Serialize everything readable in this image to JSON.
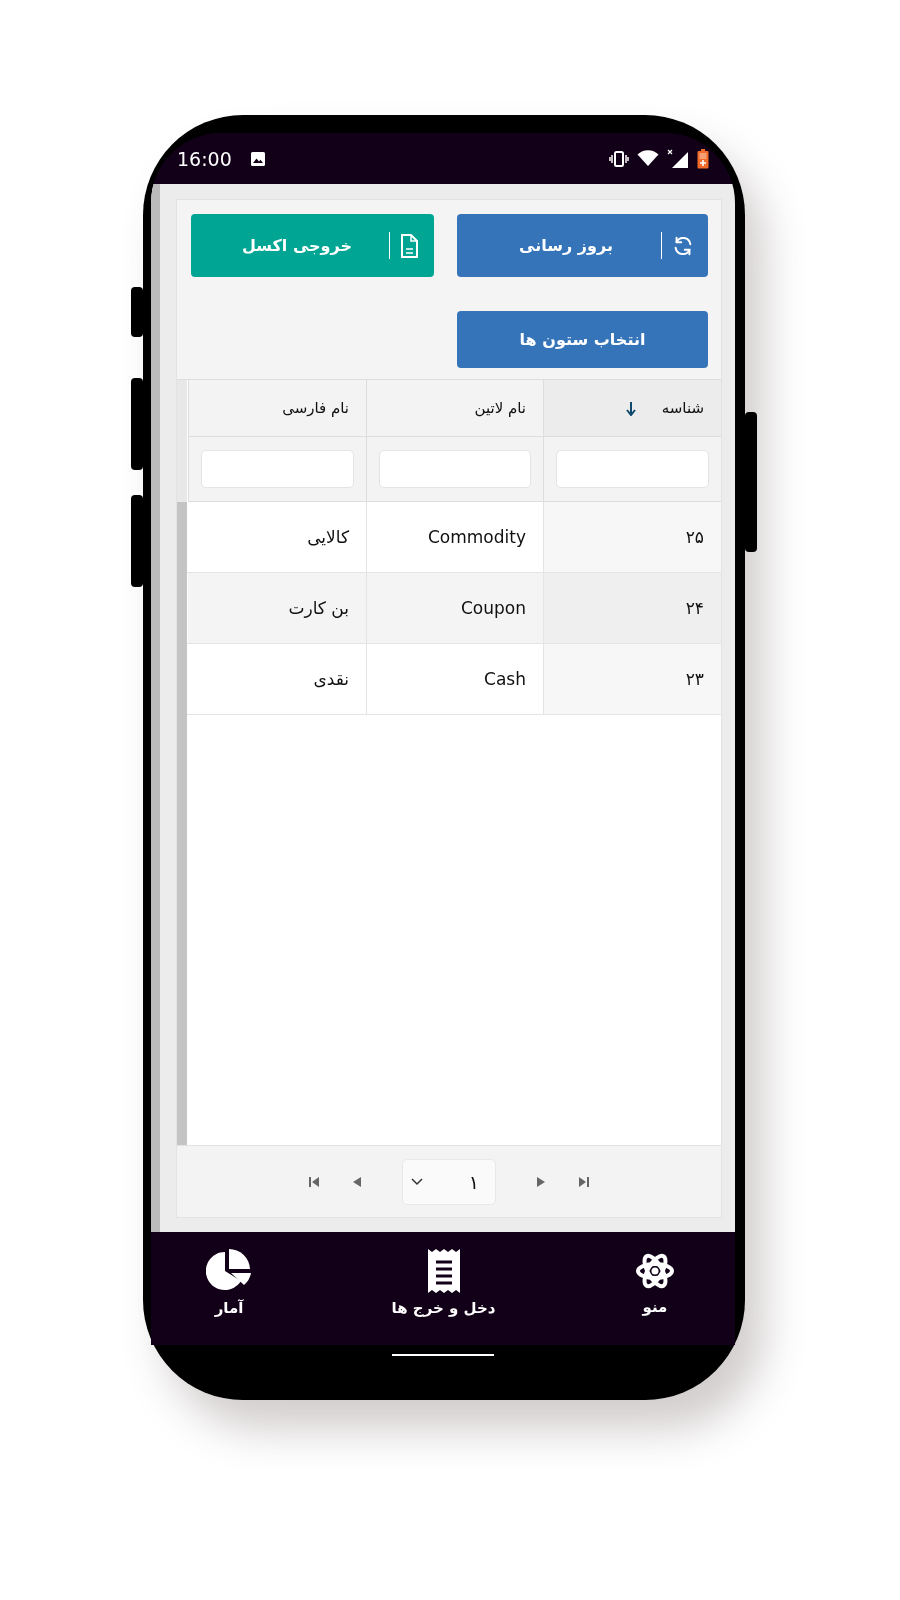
{
  "status_bar": {
    "time": "16:00"
  },
  "toolbar": {
    "buttons": [
      {
        "label": "بروز رسانی",
        "kind": "refresh"
      },
      {
        "label": "خروجی اکسل",
        "kind": "csv"
      }
    ],
    "columns_button": "انتخاب ستون ها"
  },
  "table": {
    "columns": [
      {
        "label": "شناسه",
        "sorted": true
      },
      {
        "label": "نام لاتین",
        "sorted": false
      },
      {
        "label": "نام فارسی",
        "sorted": false
      }
    ],
    "rows": [
      {
        "cells": [
          "۲۵",
          "Commodity",
          "کالایی"
        ]
      },
      {
        "cells": [
          "۲۴",
          "Coupon",
          "بن کارت"
        ]
      },
      {
        "cells": [
          "۲۳",
          "Cash",
          "نقدی"
        ]
      }
    ]
  },
  "pager": {
    "page": "۱"
  },
  "bottom_nav": {
    "items": [
      {
        "label": "منو",
        "kind": "atom"
      },
      {
        "label": "دخل و خرج ها",
        "kind": "receipt"
      },
      {
        "label": "آمار",
        "kind": "pie"
      }
    ]
  }
}
